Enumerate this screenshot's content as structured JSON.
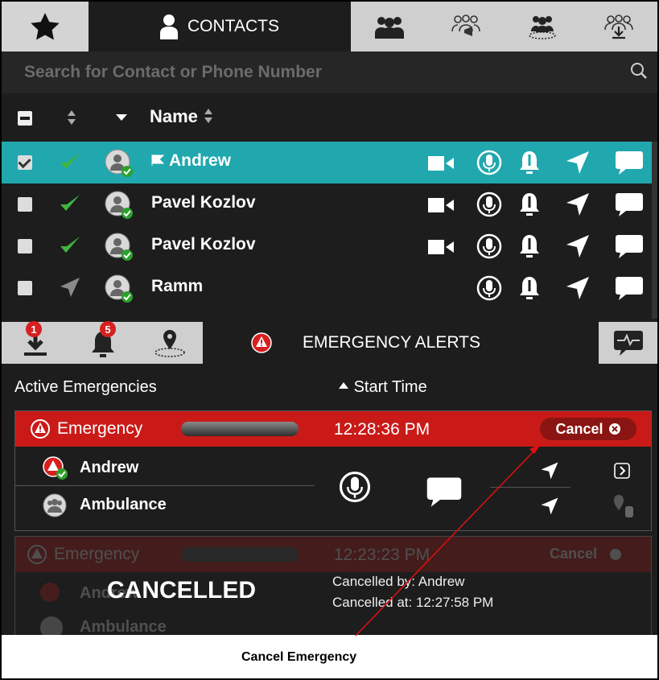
{
  "tabs": {
    "contacts_label": "CONTACTS"
  },
  "search": {
    "placeholder": "Search for Contact or Phone Number"
  },
  "list": {
    "name_header": "Name",
    "rows": [
      {
        "name": "Andrew",
        "selected": true,
        "checked": true
      },
      {
        "name": "Pavel Kozlov",
        "selected": false,
        "checked": false
      },
      {
        "name": "Pavel Kozlov",
        "selected": false,
        "checked": false
      },
      {
        "name": "Ramm",
        "selected": false,
        "checked": false
      }
    ]
  },
  "bottom_tabs": {
    "badge_alerts": "1",
    "badge_bell": "5",
    "active_label": "EMERGENCY ALERTS"
  },
  "emergencies": {
    "col_active": "Active Emergencies",
    "col_start": "Start Time",
    "active": {
      "label": "Emergency",
      "time": "12:28:36 PM",
      "cancel_label": "Cancel",
      "participants": [
        "Andrew",
        "Ambulance"
      ]
    },
    "cancelled": {
      "label": "Emergency",
      "time": "12:23:23 PM",
      "cancel_label": "Cancel",
      "participants": [
        "Andrew",
        "Ambulance"
      ],
      "status": "CANCELLED",
      "cancelled_by": "Cancelled by: Andrew",
      "cancelled_at": "Cancelled at: 12:27:58 PM"
    }
  },
  "callout": {
    "label": "Cancel Emergency"
  },
  "colors": {
    "selected_row": "#20a8ae",
    "emergency_red": "#c91a17",
    "status_green": "#2ca02c",
    "background": "#1d1d1d"
  }
}
